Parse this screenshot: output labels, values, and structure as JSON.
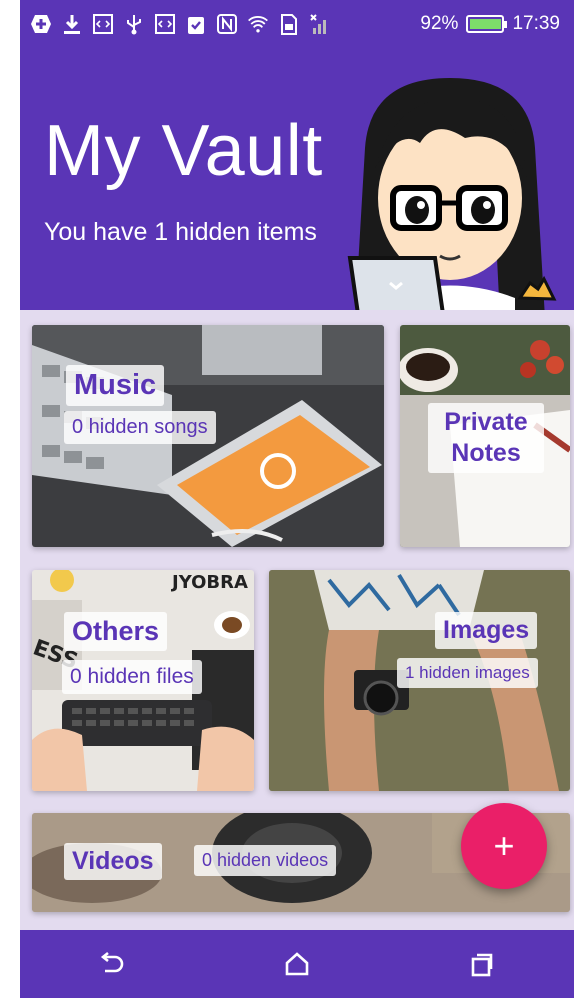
{
  "status_bar": {
    "battery_percent": "92%",
    "time": "17:39",
    "icons": [
      "plus-badge-icon",
      "download-icon",
      "code-icon",
      "usb-icon",
      "code-icon",
      "clipboard-check-icon",
      "nfc-icon",
      "wifi-icon",
      "sim-icon",
      "no-signal-icon",
      "battery-charging-icon"
    ]
  },
  "header": {
    "title": "My Vault",
    "subtitle": "You have 1 hidden items"
  },
  "tiles": {
    "music": {
      "label": "Music",
      "count": "0 hidden songs"
    },
    "notes": {
      "label": "Private Notes"
    },
    "others": {
      "label": "Others",
      "count": "0 hidden files"
    },
    "images": {
      "label": "Images",
      "count": "1 hidden images"
    },
    "videos": {
      "label": "Videos",
      "count": "0 hidden videos"
    }
  },
  "fab": {
    "symbol": "+"
  },
  "nav": {
    "icons": [
      "back-icon",
      "home-icon",
      "recents-icon"
    ]
  },
  "colors": {
    "primary": "#5a35b6",
    "accent": "#ea1f68",
    "background": "#e3dbef"
  }
}
